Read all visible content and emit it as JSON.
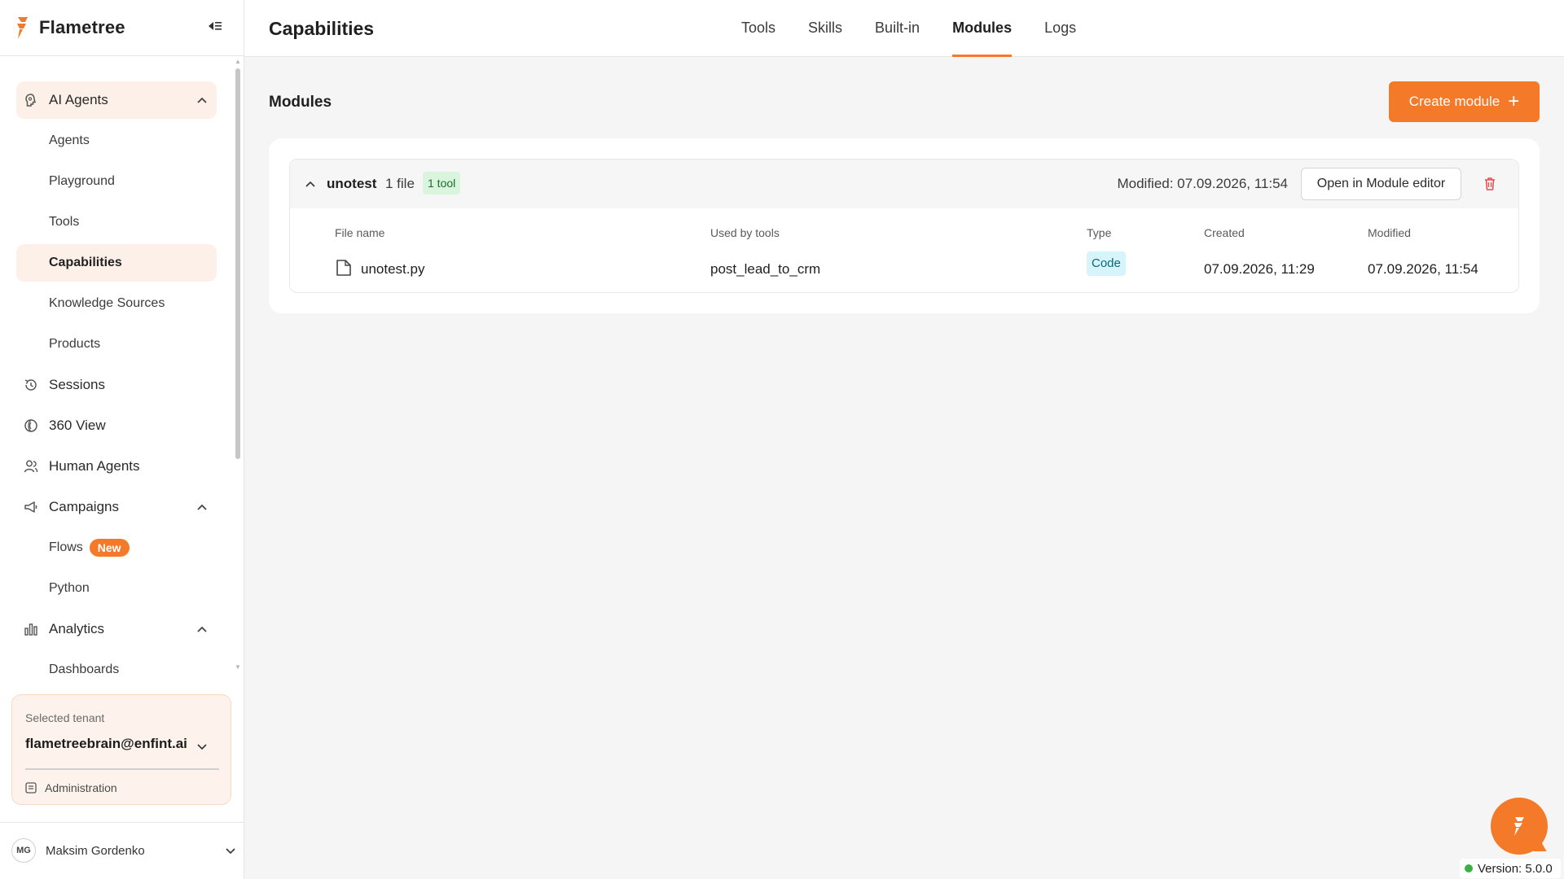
{
  "brand": {
    "name": "Flametree"
  },
  "sidebar": {
    "items": [
      {
        "label": "AI Agents",
        "icon": "brain-icon",
        "level": "top",
        "expanded": true,
        "active_group": true
      },
      {
        "label": "Agents",
        "level": "sub"
      },
      {
        "label": "Playground",
        "level": "sub"
      },
      {
        "label": "Tools",
        "level": "sub"
      },
      {
        "label": "Capabilities",
        "level": "sub",
        "active": true
      },
      {
        "label": "Knowledge Sources",
        "level": "sub"
      },
      {
        "label": "Products",
        "level": "sub"
      },
      {
        "label": "Sessions",
        "icon": "history-icon",
        "level": "top"
      },
      {
        "label": "360 View",
        "icon": "spiral-icon",
        "level": "top"
      },
      {
        "label": "Human Agents",
        "icon": "people-icon",
        "level": "top"
      },
      {
        "label": "Campaigns",
        "icon": "megaphone-icon",
        "level": "top",
        "expanded": true
      },
      {
        "label": "Flows",
        "level": "sub",
        "badge": "New"
      },
      {
        "label": "Python",
        "level": "sub"
      },
      {
        "label": "Analytics",
        "icon": "bar-chart-icon",
        "level": "top",
        "expanded": true
      },
      {
        "label": "Dashboards",
        "level": "sub"
      }
    ],
    "tenant": {
      "label": "Selected tenant",
      "value": "flametreebrain@enfint.ai",
      "admin_label": "Administration"
    },
    "user": {
      "initials": "MG",
      "name": "Maksim Gordenko"
    }
  },
  "header": {
    "title": "Capabilities",
    "tabs": [
      {
        "label": "Tools"
      },
      {
        "label": "Skills"
      },
      {
        "label": "Built-in"
      },
      {
        "label": "Modules",
        "active": true
      },
      {
        "label": "Logs"
      }
    ]
  },
  "main": {
    "section_title": "Modules",
    "create_button": "Create module",
    "modules": [
      {
        "name": "unotest",
        "files_count": "1 file",
        "tools_badge": "1 tool",
        "modified": "Modified: 07.09.2026, 11:54",
        "open_editor_label": "Open in Module editor",
        "columns": [
          "File name",
          "Used by tools",
          "Type",
          "Created",
          "Modified"
        ],
        "rows": [
          {
            "file_name": "unotest.py",
            "used_by": "post_lead_to_crm",
            "type": "Code",
            "created": "07.09.2026, 11:29",
            "modified": "07.09.2026, 11:54"
          }
        ]
      }
    ]
  },
  "version": "Version: 5.0.0",
  "colors": {
    "accent": "#f47a2a",
    "active_bg": "#fdf0e8",
    "tool_badge_bg": "#d9f5dd",
    "type_badge_bg": "#d7f4fb"
  }
}
